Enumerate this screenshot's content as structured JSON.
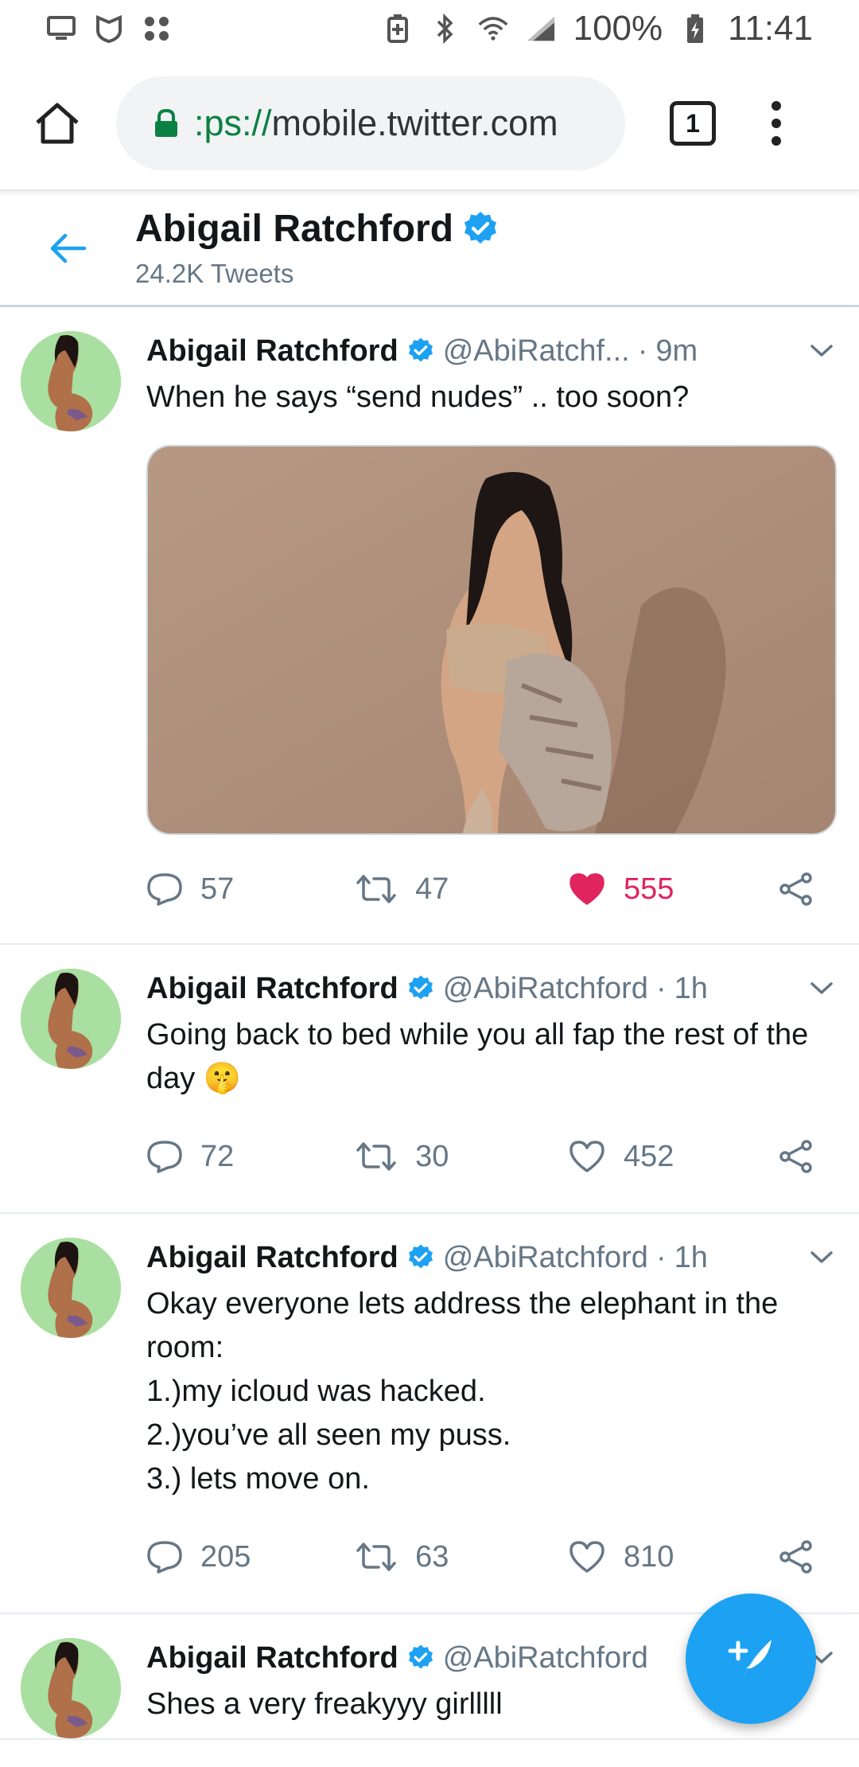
{
  "status_bar": {
    "battery": "100%",
    "time": "11:41",
    "icons": [
      "monitor-icon",
      "shield-icon",
      "apps-icon",
      "battery-saver-icon",
      "bluetooth-icon",
      "wifi-icon",
      "signal-icon",
      "battery-charging-icon"
    ]
  },
  "browser": {
    "url_scheme": ":ps://",
    "url_host": "mobile.twitter.com",
    "tab_count": "1"
  },
  "profile": {
    "name": "Abigail Ratchford",
    "tweet_count": "24.2K Tweets"
  },
  "colors": {
    "accent": "#1da1f2",
    "like": "#e0245e",
    "secondary_text": "#657786"
  },
  "tweets": [
    {
      "name": "Abigail Ratchford",
      "handle": "@AbiRatchf...",
      "time": "9m",
      "text": "When he says “send nudes” .. too soon?",
      "has_media": true,
      "replies": "57",
      "retweets": "47",
      "likes": "555",
      "liked": true
    },
    {
      "name": "Abigail Ratchford",
      "handle": "@AbiRatchford",
      "time": "1h",
      "text": "Going back to bed while you all fap the rest of the day 🤫",
      "has_media": false,
      "replies": "72",
      "retweets": "30",
      "likes": "452",
      "liked": false
    },
    {
      "name": "Abigail Ratchford",
      "handle": "@AbiRatchford",
      "time": "1h",
      "text": "Okay everyone lets address the elephant in the room:\n1.)my icloud was hacked.\n2.)you’ve all seen my puss.\n3.) lets move on.",
      "has_media": false,
      "replies": "205",
      "retweets": "63",
      "likes": "810",
      "liked": false
    },
    {
      "name": "Abigail Ratchford",
      "handle": "@AbiRatchford",
      "time": "",
      "text": "Shes a very freakyyy girlllll",
      "has_media": false,
      "replies": "",
      "retweets": "",
      "likes": "",
      "liked": false
    }
  ],
  "separator_dot": "·",
  "fab": {
    "icon": "compose-tweet-icon"
  }
}
